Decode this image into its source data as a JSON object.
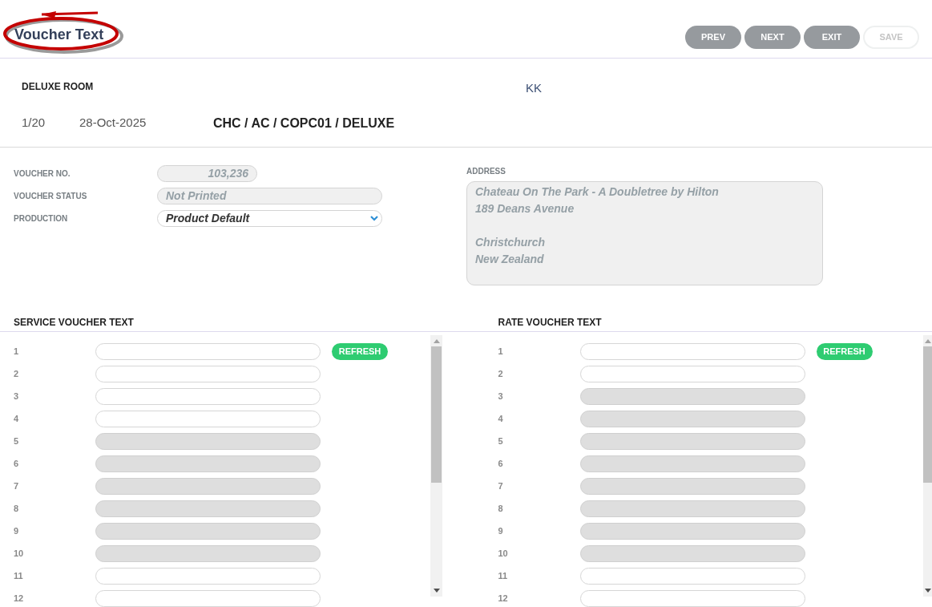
{
  "header": {
    "title": "Voucher Text",
    "buttons": [
      {
        "label": "PREV",
        "disabled": false
      },
      {
        "label": "NEXT",
        "disabled": false
      },
      {
        "label": "EXIT",
        "disabled": false
      },
      {
        "label": "SAVE",
        "disabled": true
      }
    ]
  },
  "booking": {
    "room": "DELUXE ROOM",
    "code": "KK",
    "pax": "1/20",
    "date": "28-Oct-2025",
    "route": "CHC / AC / COPC01 / DELUXE"
  },
  "fields": [
    {
      "label": "VOUCHER NO.",
      "value": "103,236",
      "kind": "number"
    },
    {
      "label": "VOUCHER STATUS",
      "value": "Not Printed",
      "kind": "text"
    },
    {
      "label": "PRODUCTION",
      "value": "Product Default",
      "kind": "select"
    }
  ],
  "address": {
    "label": "ADDRESS",
    "blocks": [
      [
        "Chateau On The Park - A Doubletree by Hilton",
        "189 Deans Avenue"
      ],
      [
        "Christchurch",
        "New Zealand"
      ]
    ]
  },
  "panels": [
    {
      "title": "SERVICE VOUCHER TEXT",
      "button": "REFRESH",
      "rows": [
        {
          "number": "1",
          "disabled": false
        },
        {
          "number": "2",
          "disabled": false
        },
        {
          "number": "3",
          "disabled": false
        },
        {
          "number": "4",
          "disabled": false
        },
        {
          "number": "5",
          "disabled": true
        },
        {
          "number": "6",
          "disabled": true
        },
        {
          "number": "7",
          "disabled": true
        },
        {
          "number": "8",
          "disabled": true
        },
        {
          "number": "9",
          "disabled": true
        },
        {
          "number": "10",
          "disabled": true
        },
        {
          "number": "11",
          "disabled": false
        },
        {
          "number": "12",
          "disabled": false
        }
      ]
    },
    {
      "title": "RATE VOUCHER TEXT",
      "button": "REFRESH",
      "rows": [
        {
          "number": "1",
          "disabled": false
        },
        {
          "number": "2",
          "disabled": false
        },
        {
          "number": "3",
          "disabled": true
        },
        {
          "number": "4",
          "disabled": true
        },
        {
          "number": "5",
          "disabled": true
        },
        {
          "number": "6",
          "disabled": true
        },
        {
          "number": "7",
          "disabled": true
        },
        {
          "number": "8",
          "disabled": true
        },
        {
          "number": "9",
          "disabled": true
        },
        {
          "number": "10",
          "disabled": true
        },
        {
          "number": "11",
          "disabled": false
        },
        {
          "number": "12",
          "disabled": false
        }
      ]
    }
  ]
}
